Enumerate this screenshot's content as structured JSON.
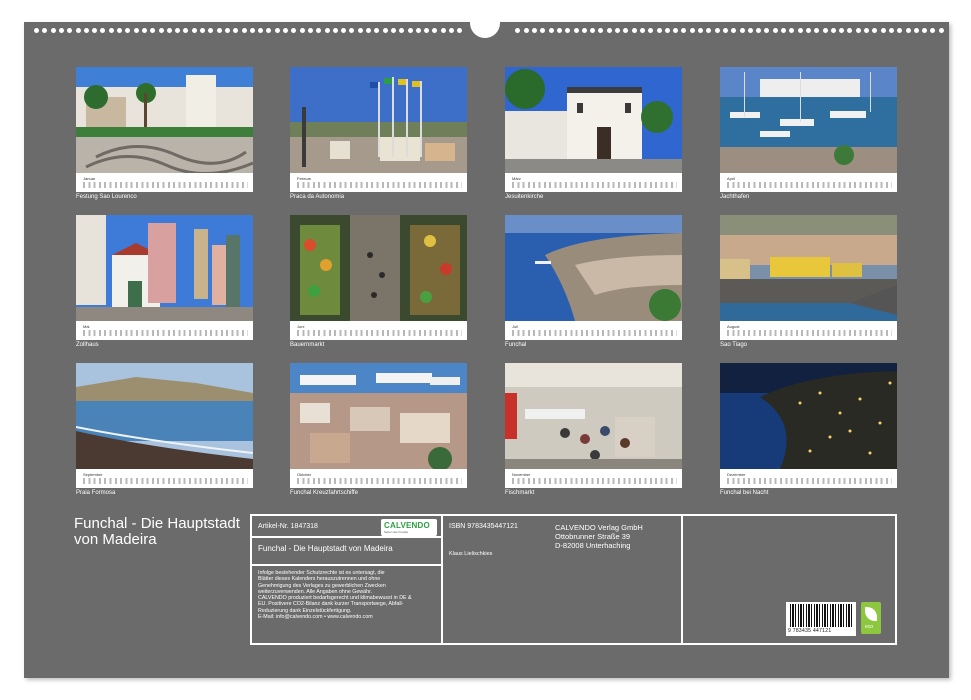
{
  "calendar": {
    "title": "Funchal - Die Hauptstadt von Madeira",
    "months": [
      {
        "month": "Januar",
        "caption": "Festung Sao Lourenco",
        "scene": "fortress"
      },
      {
        "month": "Februar",
        "caption": "Praca da Autonomia",
        "scene": "square"
      },
      {
        "month": "März",
        "caption": "Jesuitenkirche",
        "scene": "church"
      },
      {
        "month": "April",
        "caption": "Jachthafen",
        "scene": "harbor"
      },
      {
        "month": "Mai",
        "caption": "Zollhaus",
        "scene": "street"
      },
      {
        "month": "Juni",
        "caption": "Bauernmarkt",
        "scene": "market"
      },
      {
        "month": "Juli",
        "caption": "Funchal",
        "scene": "bay"
      },
      {
        "month": "August",
        "caption": "Sao Tiago",
        "scene": "fort-yellow"
      },
      {
        "month": "September",
        "caption": "Praia Formosa",
        "scene": "beach"
      },
      {
        "month": "Oktober",
        "caption": "Funchal Kreuzfahrtschiffe",
        "scene": "cruise"
      },
      {
        "month": "November",
        "caption": "Fischmarkt",
        "scene": "fishmarket"
      },
      {
        "month": "Dezember",
        "caption": "Funchal bei Nacht",
        "scene": "night"
      }
    ]
  },
  "info": {
    "article_no": "Artikel-Nr. 1847318",
    "title_repeat": "Funchal - Die Hauptstadt von Madeira",
    "legal_lines": [
      "Infolge bestehender Schutzrechte ist es untersagt, die",
      "Blätter dieses Kalenders herauszutrennen und ohne",
      "Genehmigung des Verlages zu gewerblichen Zwecken",
      "weiterzuverwenden. Alle Angaben ohne Gewähr.",
      "CALVENDO produziert bedarfsgerecht und klimabewusst in DE &",
      "EU. Positivere CO2-Bilanz dank kurzer Transportwege, Abfall-",
      "Reduzierung dank Einzelstückfertigung.",
      "E-Mail: info@calvendo.com • www.calvendo.com"
    ],
    "isbn": "ISBN 9783435447121",
    "author": "Klaus Lielischkies",
    "publisher_name": "CALVENDO Verlag GmbH",
    "publisher_street": "Ottobrunner Straße 39",
    "publisher_city": "D-82008 Unterhaching",
    "barcode_digits": "9 783435 447121",
    "logo_text": "CALVENDO",
    "logo_sub": "Seiten der Freude",
    "eco_label": "eco"
  },
  "colors": {
    "sheet": "#6b6b6b",
    "text": "#ffffff",
    "logo_green": "#2f9e44",
    "eco_green": "#8dc63f"
  }
}
